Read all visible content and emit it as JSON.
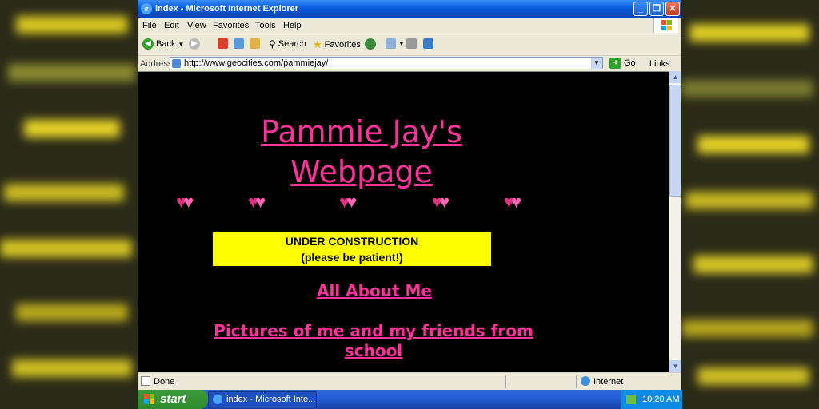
{
  "window": {
    "title": "index - Microsoft Internet Explorer",
    "min_label": "_",
    "max_label": "❐",
    "close_label": "✕"
  },
  "menu": [
    "File",
    "Edit",
    "View",
    "Favorites",
    "Tools",
    "Help"
  ],
  "toolbar": {
    "back": "Back",
    "search": "Search",
    "favorites": "Favorites"
  },
  "address": {
    "label": "Address",
    "url": "http://www.geocities.com/pammiejay/",
    "go": "Go",
    "links": "Links"
  },
  "page": {
    "title_line1": "Pammie Jay's",
    "title_line2": "Webpage",
    "construction_line1": "UNDER CONSTRUCTION",
    "construction_line2": "(please be patient!)",
    "link_about": "All About Me",
    "link_pictures_line1": "Pictures of me and my friends from",
    "link_pictures_line2": "school",
    "heart_glyph": "♥♥",
    "colors": {
      "background": "#000000",
      "pink": "#ff3399",
      "banner": "#ffff00"
    }
  },
  "status": {
    "text": "Done",
    "zone": "Internet"
  },
  "taskbar": {
    "start": "start",
    "task": "index - Microsoft Inte...",
    "clock": "10:20 AM"
  }
}
